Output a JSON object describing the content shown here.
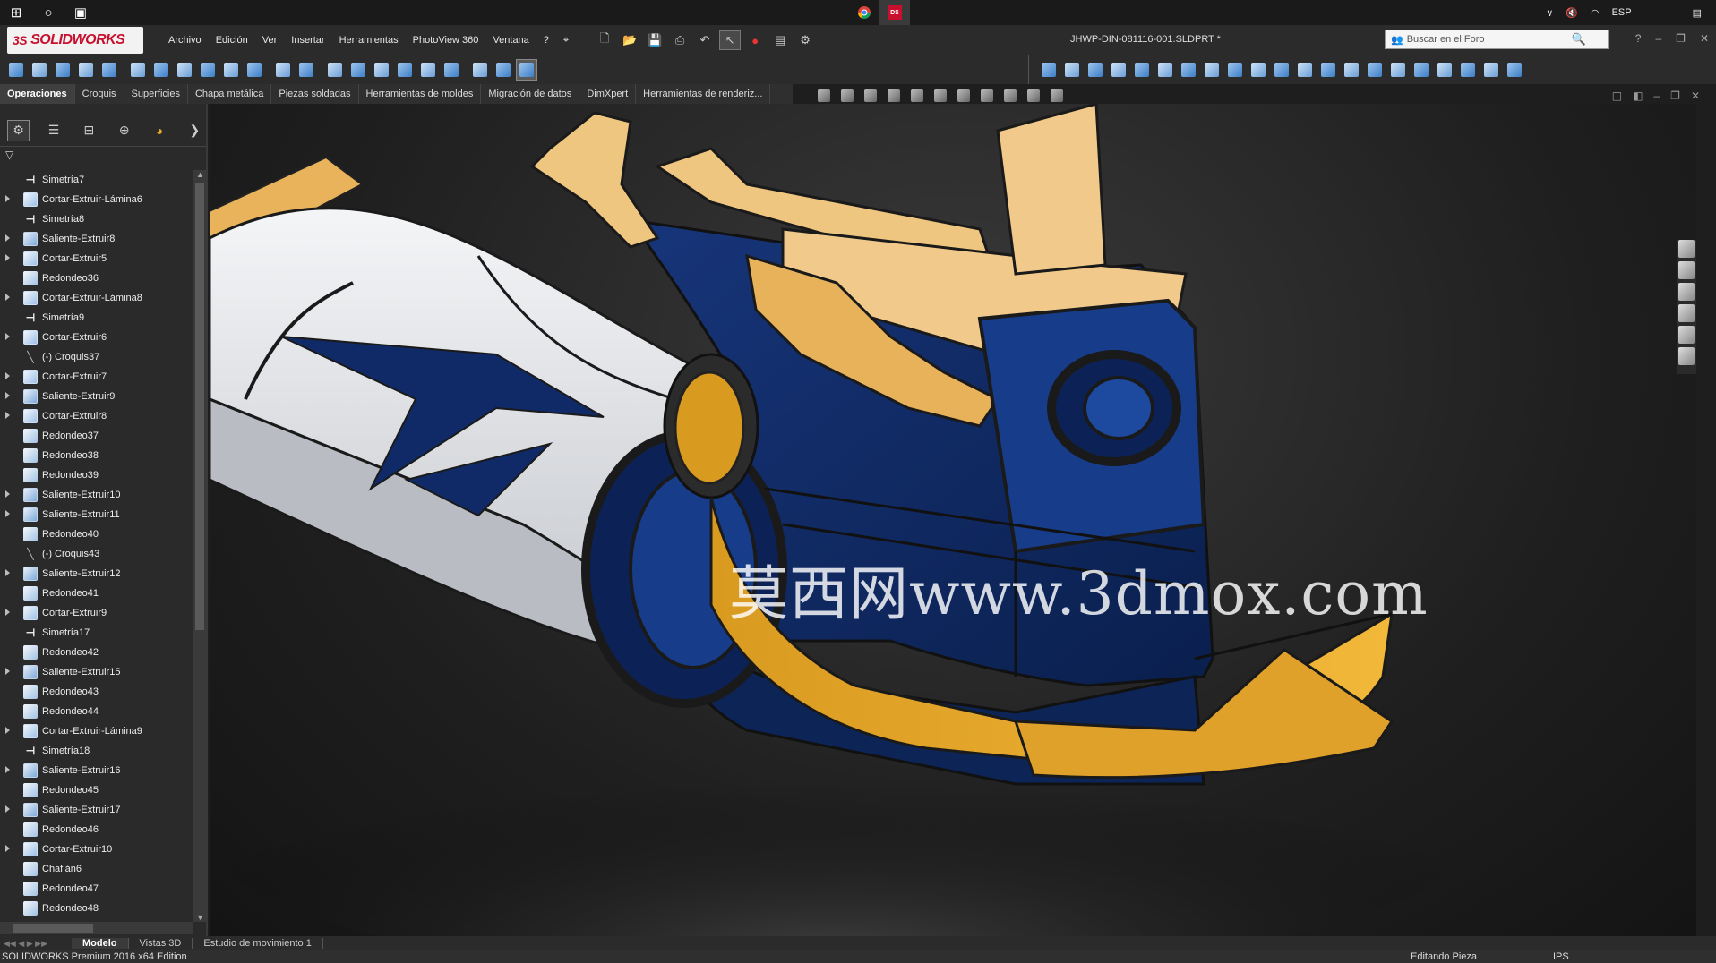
{
  "app": {
    "name": "SOLIDWORKS",
    "doc_title": "JHWP-DIN-081116-001.SLDPRT *",
    "search_placeholder": "Buscar en el Foro"
  },
  "taskbar": {
    "language": "ESP"
  },
  "menu": [
    "Archivo",
    "Edición",
    "Ver",
    "Insertar",
    "Herramientas",
    "PhotoView 360",
    "Ventana",
    "?"
  ],
  "command_tabs": [
    {
      "label": "Operaciones",
      "active": true
    },
    {
      "label": "Croquis"
    },
    {
      "label": "Superficies"
    },
    {
      "label": "Chapa metálica"
    },
    {
      "label": "Piezas soldadas"
    },
    {
      "label": "Herramientas de moldes"
    },
    {
      "label": "Migración de datos"
    },
    {
      "label": "DimXpert"
    },
    {
      "label": "Herramientas de renderiz..."
    }
  ],
  "feature_tree": [
    {
      "label": "Simetría7",
      "icon": "mirror",
      "expandable": false
    },
    {
      "label": "Cortar-Extruir-Lámina6",
      "icon": "cut",
      "expandable": true
    },
    {
      "label": "Simetría8",
      "icon": "mirror",
      "expandable": false
    },
    {
      "label": "Saliente-Extruir8",
      "icon": "boss",
      "expandable": true
    },
    {
      "label": "Cortar-Extruir5",
      "icon": "cut",
      "expandable": true
    },
    {
      "label": "Redondeo36",
      "icon": "fillet",
      "expandable": false
    },
    {
      "label": "Cortar-Extruir-Lámina8",
      "icon": "cut",
      "expandable": true
    },
    {
      "label": "Simetría9",
      "icon": "mirror",
      "expandable": false
    },
    {
      "label": "Cortar-Extruir6",
      "icon": "cut",
      "expandable": true
    },
    {
      "label": "(-) Croquis37",
      "icon": "sketch",
      "expandable": false
    },
    {
      "label": "Cortar-Extruir7",
      "icon": "cut",
      "expandable": true
    },
    {
      "label": "Saliente-Extruir9",
      "icon": "boss",
      "expandable": true
    },
    {
      "label": "Cortar-Extruir8",
      "icon": "cut",
      "expandable": true
    },
    {
      "label": "Redondeo37",
      "icon": "fillet",
      "expandable": false
    },
    {
      "label": "Redondeo38",
      "icon": "fillet",
      "expandable": false
    },
    {
      "label": "Redondeo39",
      "icon": "fillet",
      "expandable": false
    },
    {
      "label": "Saliente-Extruir10",
      "icon": "boss",
      "expandable": true
    },
    {
      "label": "Saliente-Extruir11",
      "icon": "boss",
      "expandable": true
    },
    {
      "label": "Redondeo40",
      "icon": "fillet",
      "expandable": false
    },
    {
      "label": "(-) Croquis43",
      "icon": "sketch",
      "expandable": false
    },
    {
      "label": "Saliente-Extruir12",
      "icon": "boss",
      "expandable": true
    },
    {
      "label": "Redondeo41",
      "icon": "fillet",
      "expandable": false
    },
    {
      "label": "Cortar-Extruir9",
      "icon": "cut",
      "expandable": true
    },
    {
      "label": "Simetría17",
      "icon": "mirror",
      "expandable": false
    },
    {
      "label": "Redondeo42",
      "icon": "fillet",
      "expandable": false
    },
    {
      "label": "Saliente-Extruir15",
      "icon": "boss",
      "expandable": true
    },
    {
      "label": "Redondeo43",
      "icon": "fillet",
      "expandable": false
    },
    {
      "label": "Redondeo44",
      "icon": "fillet",
      "expandable": false
    },
    {
      "label": "Cortar-Extruir-Lámina9",
      "icon": "cut",
      "expandable": true
    },
    {
      "label": "Simetría18",
      "icon": "mirror",
      "expandable": false
    },
    {
      "label": "Saliente-Extruir16",
      "icon": "boss",
      "expandable": true
    },
    {
      "label": "Redondeo45",
      "icon": "fillet",
      "expandable": false
    },
    {
      "label": "Saliente-Extruir17",
      "icon": "boss",
      "expandable": true
    },
    {
      "label": "Redondeo46",
      "icon": "fillet",
      "expandable": false
    },
    {
      "label": "Cortar-Extruir10",
      "icon": "cut",
      "expandable": true
    },
    {
      "label": "Chaflán6",
      "icon": "chamfer",
      "expandable": false
    },
    {
      "label": "Redondeo47",
      "icon": "fillet",
      "expandable": false
    },
    {
      "label": "Redondeo48",
      "icon": "fillet",
      "expandable": false
    }
  ],
  "bottom_tabs": [
    {
      "label": "Modelo",
      "active": true
    },
    {
      "label": "Vistas 3D"
    },
    {
      "label": "Estudio de movimiento 1"
    }
  ],
  "status": {
    "edition": "SOLIDWORKS Premium 2016 x64 Edition",
    "mode": "Editando Pieza",
    "units": "IPS"
  },
  "watermark": "莫西网www.3dmox.com",
  "colors": {
    "navy": "#0f2a66",
    "gold": "#e8a82a",
    "cream": "#f1c98a",
    "white_blade": "#e9ebee"
  }
}
